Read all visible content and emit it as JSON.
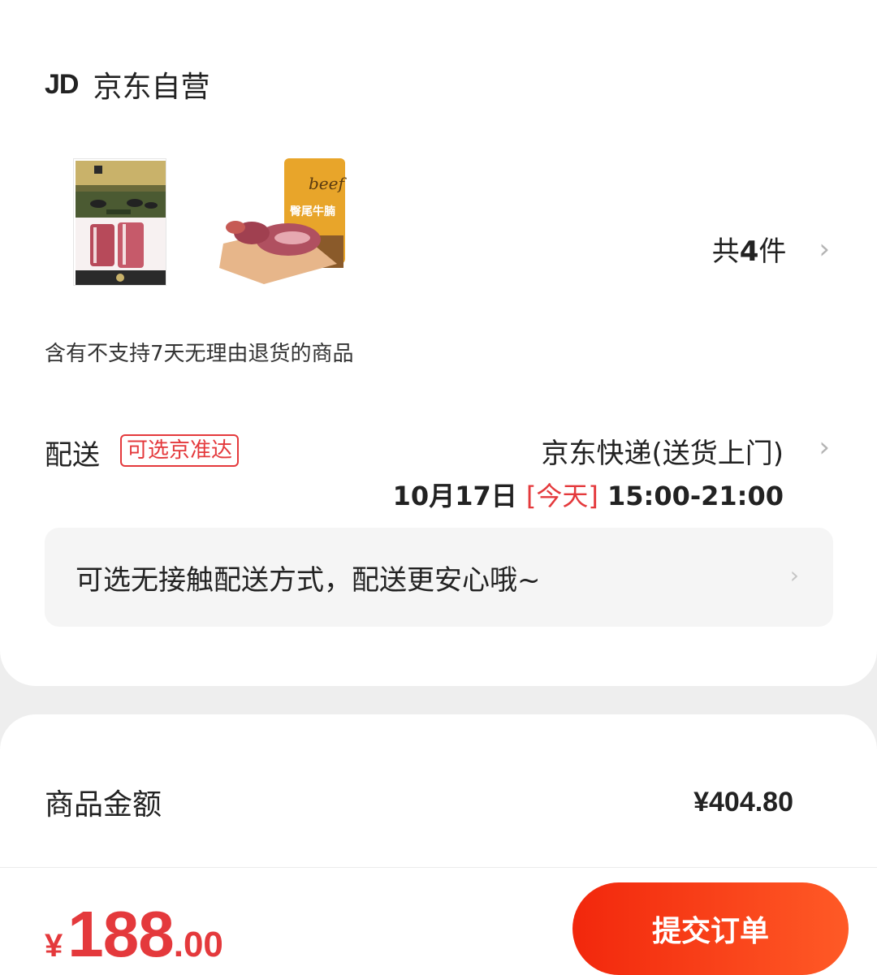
{
  "shop": {
    "logo": "JD",
    "name": "京东自营"
  },
  "items": {
    "count_prefix": "共",
    "count_num": "4",
    "count_suffix": "件",
    "thumbnails": [
      "product-beef-ribs-icon",
      "product-beef-brisket-icon"
    ],
    "thumb2_brand": "beef",
    "thumb2_label": "臀尾牛腩"
  },
  "notice": "含有不支持7天无理由退货的商品",
  "delivery": {
    "label": "配送",
    "badge": "可选京准达",
    "method": "京东快递(送货上门)",
    "date": "10月17日",
    "today": "[今天]",
    "time": "15:00-21:00"
  },
  "contactless": {
    "text": "可选无接触配送方式，配送更安心哦~"
  },
  "summary": {
    "amount_label": "商品金额",
    "amount_value": "¥404.80"
  },
  "footer": {
    "currency": "¥",
    "total_int": "188",
    "total_dec": ".00",
    "submit_label": "提交订单"
  },
  "colors": {
    "accent": "#e4393c",
    "button_start": "#f2270c",
    "button_end": "#ff5a26"
  }
}
